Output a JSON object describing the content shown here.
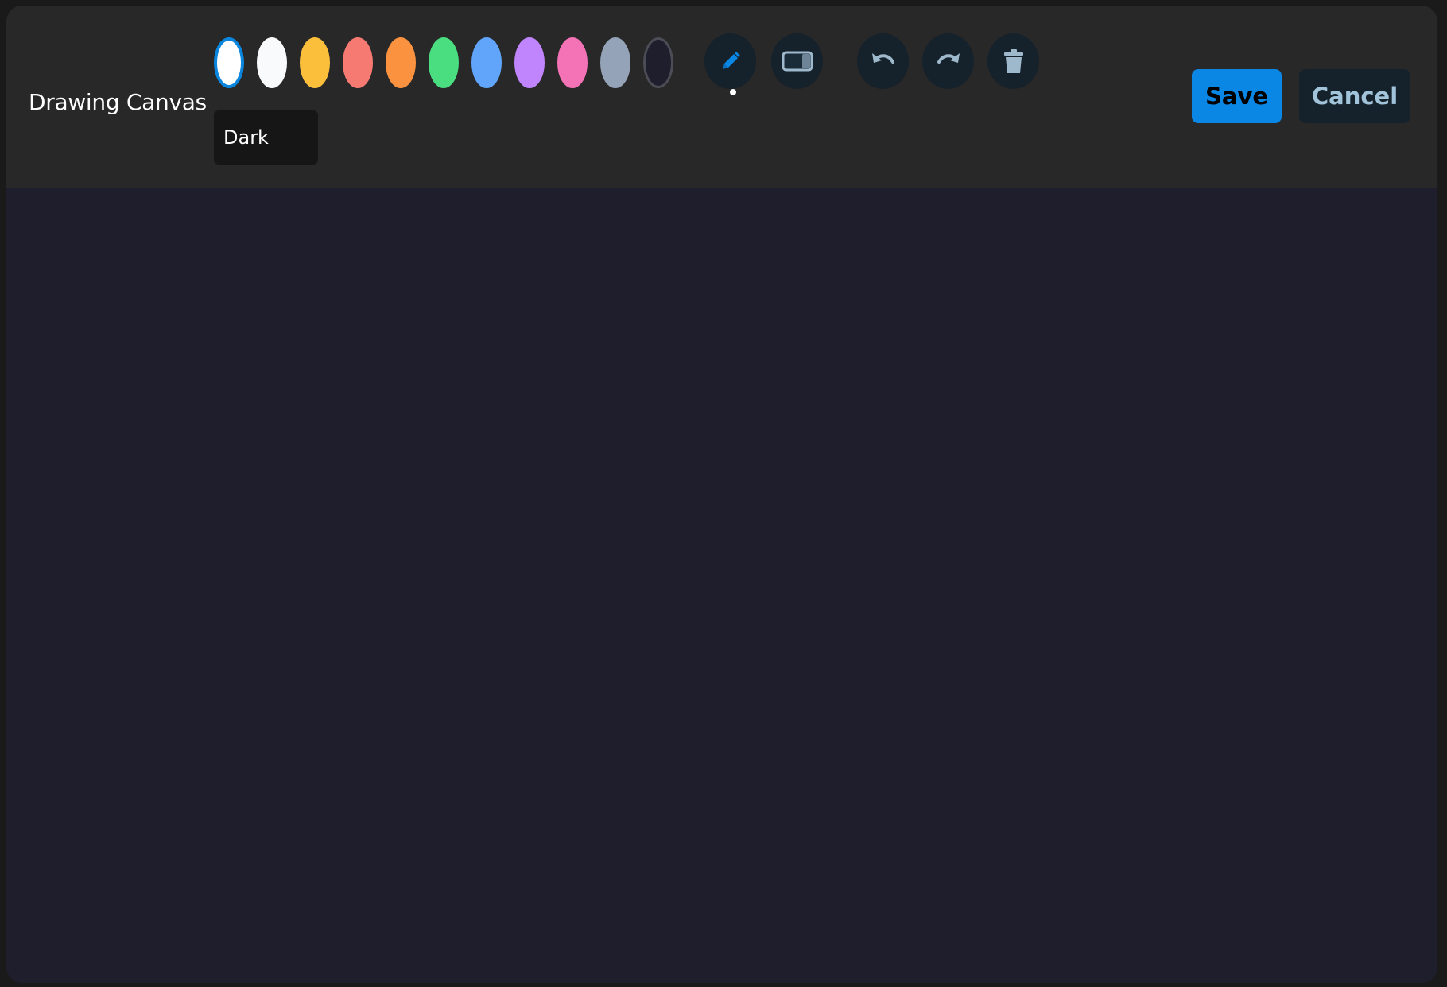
{
  "window": {
    "title": "Drawing Canvas"
  },
  "palette": {
    "selected_index": 0,
    "colors": [
      "#ffffff",
      "#f8fafc",
      "#fbbf3c",
      "#f77a72",
      "#fb923f",
      "#4ade80",
      "#60a5fa",
      "#c084fc",
      "#f472b6",
      "#94a3b8",
      "#1f1e2c"
    ],
    "theme_label": "Dark"
  },
  "tools": {
    "pen_icon": "pencil-icon",
    "eraser_icon": "eraser-icon",
    "undo_icon": "undo-icon",
    "redo_icon": "redo-icon",
    "clear_icon": "trash-icon",
    "active_tool": "pen"
  },
  "actions": {
    "save_label": "Save",
    "cancel_label": "Cancel"
  },
  "colors": {
    "accent": "#0a86e4",
    "toolbar_bg": "#282828",
    "canvas_bg": "#1f1e2c",
    "icon_button_bg": "#15212b"
  }
}
